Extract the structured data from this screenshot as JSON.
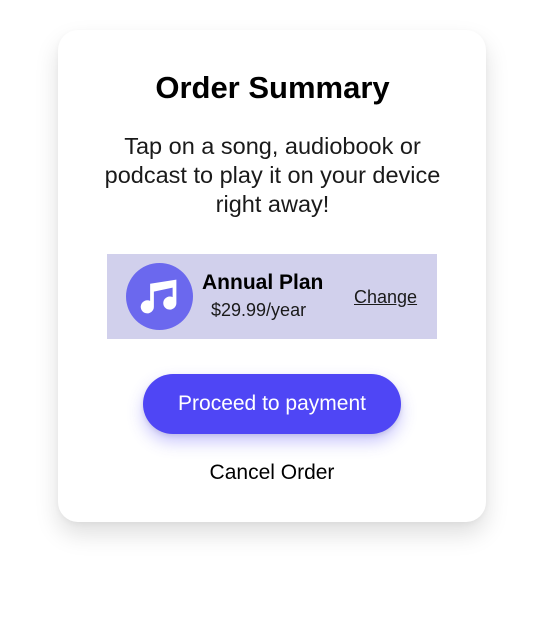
{
  "dialog": {
    "title": "Order Summary",
    "description": "Tap on a song, audiobook or podcast to play it on your device right away!"
  },
  "plan": {
    "icon": "music-note-icon",
    "name": "Annual Plan",
    "price": "$29.99/year",
    "change_label": "Change"
  },
  "actions": {
    "proceed_label": "Proceed to payment",
    "cancel_label": "Cancel Order"
  },
  "colors": {
    "accent": "#4f46f5",
    "plan_background": "#d1d0ec",
    "plan_icon_background": "#6b68ee"
  }
}
